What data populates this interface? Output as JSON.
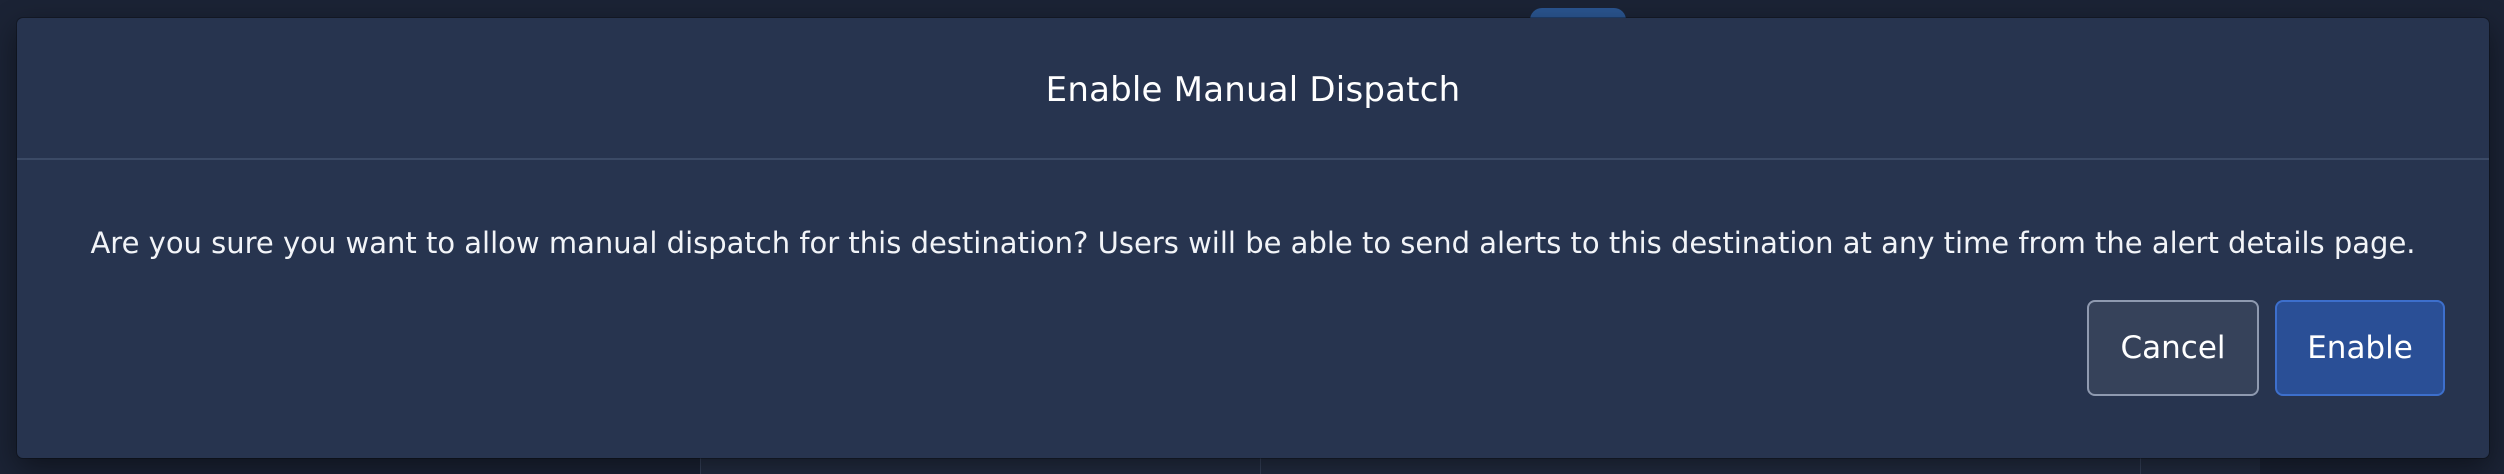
{
  "dialog": {
    "title": "Enable Manual Dispatch",
    "message": "Are you sure you want to allow manual dispatch for this destination? Users will be able to send alerts to this destination at any time from the alert details page.",
    "cancel_label": "Cancel",
    "confirm_label": "Enable"
  },
  "colors": {
    "dialog_background": "#27344f",
    "page_background": "#1b2335",
    "primary_button": "#2a4f96",
    "secondary_button": "#36425a"
  }
}
